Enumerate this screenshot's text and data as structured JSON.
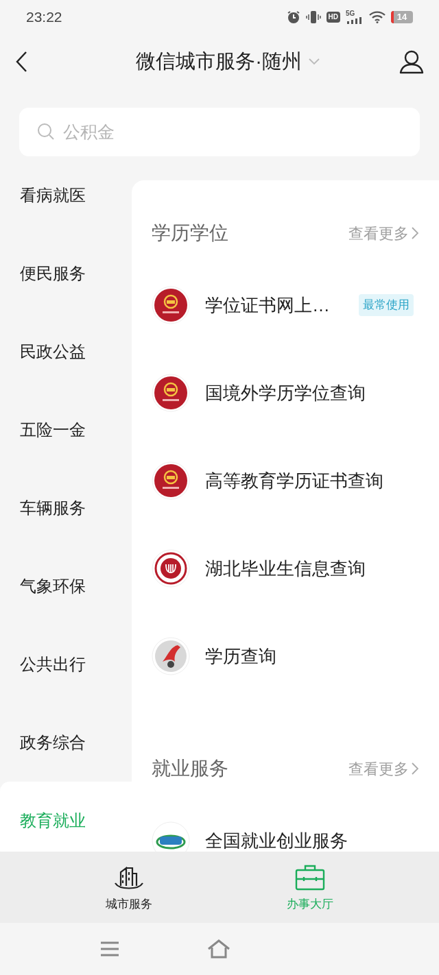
{
  "status_bar": {
    "time": "23:22",
    "hd": "HD",
    "network": "5G",
    "battery": "14"
  },
  "header": {
    "title": "微信城市服务·随州"
  },
  "search": {
    "placeholder": "公积金"
  },
  "sidebar": {
    "items": [
      {
        "label": "看病就医",
        "selected": false
      },
      {
        "label": "便民服务",
        "selected": false
      },
      {
        "label": "民政公益",
        "selected": false
      },
      {
        "label": "五险一金",
        "selected": false
      },
      {
        "label": "车辆服务",
        "selected": false
      },
      {
        "label": "气象环保",
        "selected": false
      },
      {
        "label": "公共出行",
        "selected": false
      },
      {
        "label": "政务综合",
        "selected": false
      },
      {
        "label": "教育就业",
        "selected": true
      }
    ]
  },
  "sections": [
    {
      "title": "学历学位",
      "more": "查看更多",
      "items": [
        {
          "label": "学位证书网上…",
          "badge": "最常使用"
        },
        {
          "label": "国境外学历学位查询"
        },
        {
          "label": "高等教育学历证书查询"
        },
        {
          "label": "湖北毕业生信息查询"
        },
        {
          "label": "学历查询"
        }
      ]
    },
    {
      "title": "就业服务",
      "more": "查看更多",
      "items": [
        {
          "label": "全国就业创业服务"
        }
      ]
    }
  ],
  "tab_bar": [
    {
      "label": "城市服务",
      "selected": false
    },
    {
      "label": "办事大厅",
      "selected": true
    }
  ]
}
